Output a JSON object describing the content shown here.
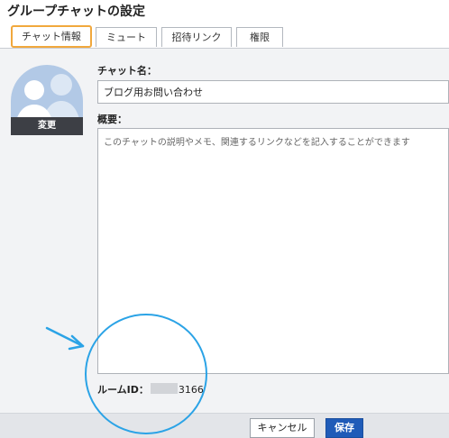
{
  "dialog": {
    "title": "グループチャットの設定"
  },
  "tabs": [
    {
      "label": "チャット情報",
      "active": true
    },
    {
      "label": "ミュート",
      "active": false
    },
    {
      "label": "招待リンク",
      "active": false
    },
    {
      "label": "権限",
      "active": false
    }
  ],
  "avatar": {
    "icon": "group-avatar-icon",
    "change_label": "変更"
  },
  "chat_name": {
    "label": "チャット名：",
    "value": "ブログ用お問い合わせ"
  },
  "description": {
    "label": "概要：",
    "placeholder": "このチャットの説明やメモ、関連するリンクなどを記入することができます",
    "value": ""
  },
  "room_id": {
    "label": "ルームID：",
    "value_visible": "3166"
  },
  "footer": {
    "cancel_label": "キャンセル",
    "save_label": "保存"
  },
  "colors": {
    "active_tab_border": "#f1a83d",
    "save_button": "#1f5bb8",
    "annotation": "#2ba3e6",
    "avatar_bg": "#b2c9e6"
  }
}
